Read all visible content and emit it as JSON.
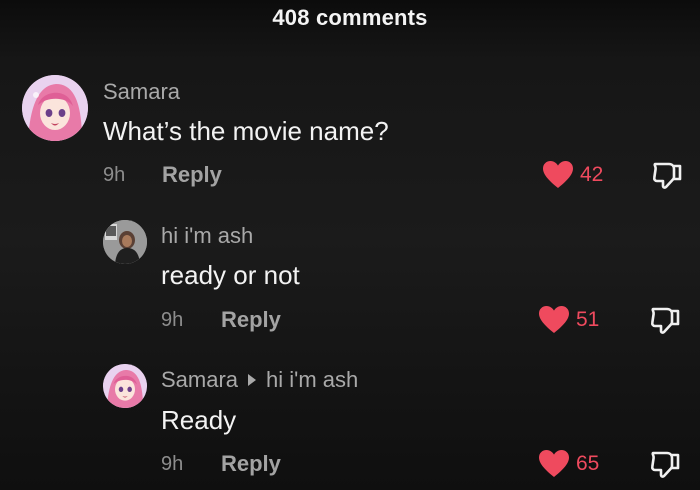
{
  "header": {
    "comments_count": "408 comments"
  },
  "comments": [
    {
      "username": "Samara",
      "text": "What’s the movie name?",
      "time": "9h",
      "reply_label": "Reply",
      "likes": "42"
    },
    {
      "username": "hi i'm ash",
      "text": "ready or not",
      "time": "9h",
      "reply_label": "Reply",
      "likes": "51"
    },
    {
      "username": "Samara",
      "reply_to": "hi i'm ash",
      "text": "Ready",
      "time": "9h",
      "reply_label": "Reply",
      "likes": "65"
    }
  ],
  "colors": {
    "like_red": "#ef4a5e",
    "text_primary": "#f3f3f3",
    "text_secondary": "#a9a9a9",
    "background": "#141414"
  },
  "icons": {
    "like": "heart-icon",
    "dislike": "thumbs-down-icon",
    "reply_arrow": "caret-right-icon"
  }
}
